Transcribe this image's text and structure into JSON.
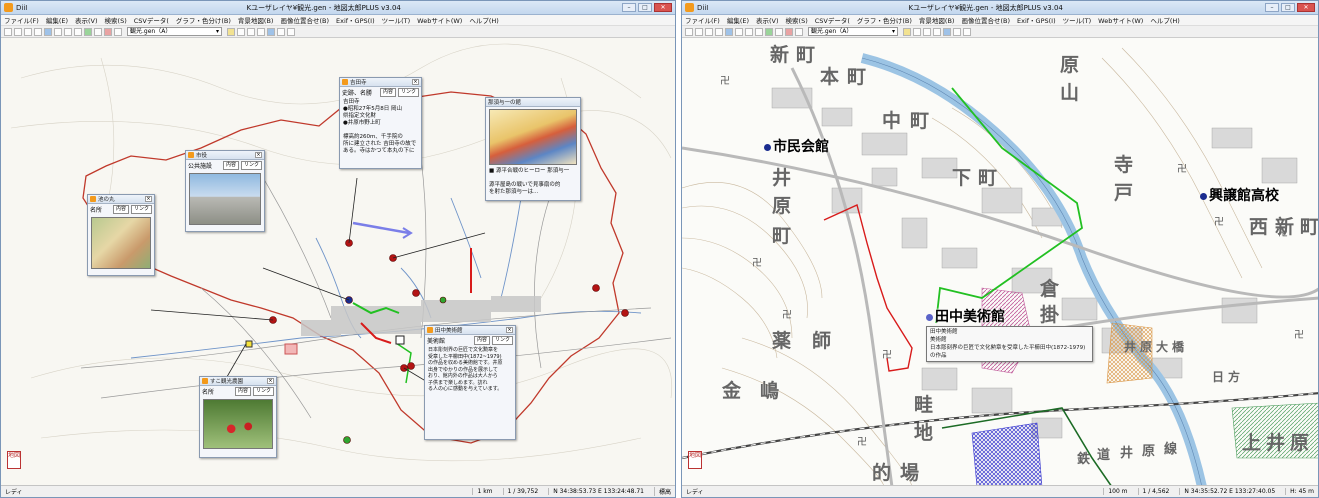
{
  "window1": {
    "app": "DiiI",
    "title": "Kユーザレイヤ¥観光.gen - 地図太郎PLUS v3.04",
    "menu": [
      "ファイル(F)",
      "編集(E)",
      "表示(V)",
      "検索(S)",
      "CSVデータ(",
      ")",
      "グラフ・色分け(B)",
      "背景地図(B)",
      "画像位置合せ(B)",
      "Exif・GPS(I)",
      "ツール(T)",
      "Webサイト(W)",
      "ヘルプ(H)"
    ],
    "layer_select": "観光.gen（A）",
    "status": {
      "ready": "レディ",
      "scale_bar": "1 km",
      "scale": "1 / 39,752",
      "coords": "N 34:38:53.73  E 133:24:48.71",
      "altitude": "標高"
    },
    "popups": {
      "ikenaka": {
        "title": "池の丸",
        "name": "名所",
        "btn1": "内容",
        "btn2": "リンク"
      },
      "shiyakusho": {
        "title": "市役",
        "name": "公共施設",
        "btn1": "内容",
        "btn2": "リンク"
      },
      "yoshida": {
        "title": "吉田寺",
        "name": "史跡、名勝",
        "btn1": "内容",
        "btn2": "リンク",
        "body": "吉田寺\n●昭和27年5月8日 岡山\n県指定文化財\n●井原市野上町\n\n標高約260m、千手院の\n所に建立された 吉田寺の故で\nある。寺はかつて本丸の下に"
      },
      "nasu": {
        "title": "那須与一の館",
        "body": "■ 源平合戦のヒーロー  那須与一\n\n源平屋島の戦いで見事扇の的\nを射た那須与一は…"
      },
      "museum": {
        "title": "田中美術館",
        "name": "美術館",
        "btn1": "内容",
        "btn2": "リンク",
        "body": "日本彫刻界の巨匠で文化勲章を\n受章した平櫛田中(1872~1979)\nの作品を収める美術館です。井原\n出身でゆかりの作品を展示して\nおり、館内外の作品は大人から\n子供まで楽しめます。訪れ\nる人の心に感動を与えています。"
      },
      "ichigo": {
        "title": "すこ観光農園",
        "name": "名所",
        "btn1": "内容",
        "btn2": "リンク"
      }
    }
  },
  "window2": {
    "app": "DiiI",
    "title": "Kユーザレイヤ¥観光.gen - 地図太郎PLUS v3.04",
    "menu": [
      "ファイル(F)",
      "編集(E)",
      "表示(V)",
      "検索(S)",
      "CSVデータ(",
      ")",
      "グラフ・色分け(B)",
      "背景地図(B)",
      "画像位置合せ(B)",
      "Exif・GPS(I)",
      "ツール(T)",
      "Webサイト(W)",
      "ヘルプ(H)"
    ],
    "layer_select": "観光.gen（A）",
    "labels": {
      "shimin": "市民会館",
      "kojokan": "興譲館高校",
      "tanaka": "田中美術館"
    },
    "tooltip": "田中美術館\n美術館\n日本彫刻界の巨匠で文化勲章を受章した平櫛田中(1872-1979)の作品",
    "place_names": [
      "新",
      "町",
      "本",
      "町",
      "中",
      "町",
      "下",
      "町",
      "井",
      "原",
      "町",
      "寺",
      "戸",
      "西",
      "新",
      "町",
      "原",
      "山",
      "薬",
      "師",
      "金",
      "嶋",
      "畦",
      "地",
      "的",
      "場",
      "倉",
      "掛",
      "井",
      "原",
      "大",
      "橋",
      "日",
      "方",
      "上",
      "井",
      "原",
      "鉄",
      "道",
      "井",
      "原",
      "線"
    ],
    "status": {
      "ready": "レディ",
      "scale_bar": "100 m",
      "scale": "1 / 4,562",
      "coords": "N 34:35:52.72  E 133:27:40.05",
      "altitude": "H: 45 m"
    }
  },
  "colors": {
    "accent": "#f39a1c",
    "boundary": "#c0392b",
    "route_green": "#22c022",
    "route_red": "#d81b1b",
    "poi_blue": "#1a2c8f"
  }
}
